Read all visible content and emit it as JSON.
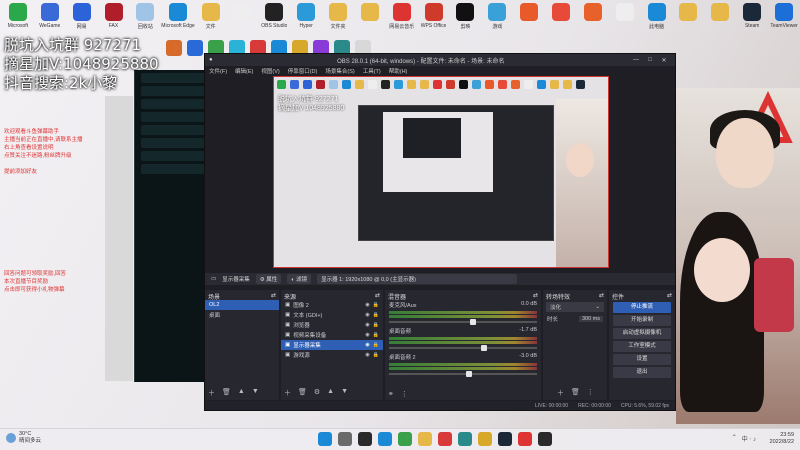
{
  "desktop": {
    "icons": [
      {
        "label": "Microsoft",
        "color": "#2aa84a"
      },
      {
        "label": "WeGame",
        "color": "#3a6ad8"
      },
      {
        "label": "网易",
        "color": "#2d63d8"
      },
      {
        "label": "FAX",
        "color": "#b01e2a"
      },
      {
        "label": "回收站",
        "color": "#9fc4e6"
      },
      {
        "label": "Microsoft Edge",
        "color": "#1b8ad6"
      },
      {
        "label": "文件",
        "color": "#e6b84a"
      },
      {
        "label": "",
        "color": "#eee"
      },
      {
        "label": "OBS Studio",
        "color": "#222"
      },
      {
        "label": "Hyper",
        "color": "#2a9ad8"
      },
      {
        "label": "文件夹",
        "color": "#e6b84a"
      },
      {
        "label": "",
        "color": "#e6b84a"
      },
      {
        "label": "网易云音乐",
        "color": "#d33"
      },
      {
        "label": "WPS Office",
        "color": "#d03a2a"
      },
      {
        "label": "剪映",
        "color": "#111"
      },
      {
        "label": "游戏",
        "color": "#3aa0d8"
      },
      {
        "label": "",
        "color": "#e85a2a"
      },
      {
        "label": "",
        "color": "#e84a3a"
      },
      {
        "label": "",
        "color": "#e8602a"
      },
      {
        "label": "",
        "color": "#eee"
      },
      {
        "label": "此电脑",
        "color": "#1b8ad6"
      },
      {
        "label": "",
        "color": "#e6b84a"
      },
      {
        "label": "",
        "color": "#e6b84a"
      },
      {
        "label": "Steam",
        "color": "#1b2838"
      },
      {
        "label": "TeamViewer",
        "color": "#1d6fd8"
      }
    ],
    "row2_colors": [
      "#d66a2a",
      "#2a6ad8",
      "#3aa04a",
      "#2ab2d8",
      "#d83a3a",
      "#1b8ad6",
      "#d8a82a",
      "#8a3ad8",
      "#2a8a8a",
      "#d8d8d8"
    ]
  },
  "overlay": {
    "line1": "脱坑入坑群 927271",
    "line2": "摘星加V:1048925880",
    "line3": "抖音搜索:2k小黎"
  },
  "notes": {
    "block1": [
      "欢迎观看斗鱼弹幕助手",
      "主播当前正在直播中,请联系主播",
      "右上角查看设置说明",
      "点赞关注不迷路,粉丝牌升级",
      "",
      "提前添加好友"
    ],
    "block2": [
      "回答问题可领取奖励,回答",
      "本次直播节目奖励",
      "点击即可获得小礼物弹幕"
    ]
  },
  "obs": {
    "title": "OBS 28.0.1 (64-bit, windows) - 配置文件: 未命名 - 场景: 未命名",
    "menu": [
      "文件(F)",
      "编辑(E)",
      "视图(V)",
      "停靠窗口(D)",
      "场景集合(S)",
      "工具(T)",
      "帮助(H)"
    ],
    "source_bar": {
      "selected": "显示器采集",
      "properties": "属性",
      "filters": "滤镜",
      "display": "显示器 1: 1920x1080 @ 0,0 (主显示器)"
    },
    "scenes": {
      "title": "场景",
      "items": [
        "OL2",
        "桌面"
      ]
    },
    "sources": {
      "title": "来源",
      "items": [
        "图像 2",
        "文本 (GDI+)",
        "浏览器",
        "视频采集设备",
        "显示器采集",
        "游戏源"
      ]
    },
    "mixer": {
      "title": "混音器",
      "channels": [
        {
          "name": "麦克风/Aux",
          "db": "0.0 dB",
          "level": 0.55
        },
        {
          "name": "桌面音频",
          "db": "-1.7 dB",
          "level": 0.62
        },
        {
          "name": "桌面音频 2",
          "db": "-3.0 dB",
          "level": 0.52
        }
      ]
    },
    "transitions": {
      "title": "转场特效",
      "type": "淡化",
      "duration_label": "时长",
      "duration": "300 ms"
    },
    "controls": {
      "title": "控件",
      "buttons": [
        "停止推流",
        "开始录制",
        "启动虚拟摄像机",
        "工作室模式",
        "设置",
        "退出"
      ]
    },
    "status": {
      "live": "LIVE: 00:00:00",
      "rec": "REC: 00:00:00",
      "cpu": "CPU: 5.6%, 59.02 fps"
    },
    "preview_overlay": [
      "脱坑入坑群 927271",
      "摘星加V:1048925880"
    ]
  },
  "taskbar": {
    "weather_temp": "30°C",
    "weather_desc": "晴间多云",
    "apps_colors": [
      "#1b8ad6",
      "#6a6a6a",
      "#2a2a2a",
      "#1b8ad6",
      "#3aa04a",
      "#e6b84a",
      "#d83a3a",
      "#2a8a8a",
      "#d8a82a",
      "#1b2838",
      "#d33",
      "#2a2a2a"
    ],
    "time": "23:59",
    "date": "2022/8/22",
    "tray": "中 ⋅ ♪"
  }
}
